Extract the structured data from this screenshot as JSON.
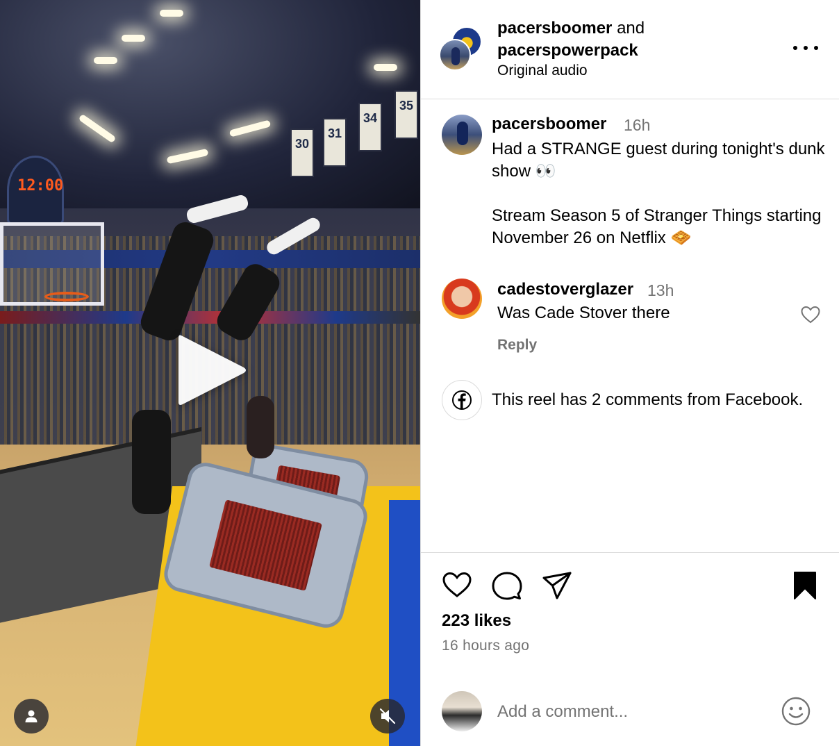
{
  "post": {
    "header": {
      "author1": "pacersboomer",
      "joiner": "and",
      "author2": "pacerspowerpack",
      "audio": "Original audio"
    },
    "caption": {
      "username": "pacersboomer",
      "time": "16h",
      "text": "Had a STRANGE guest during tonight's dunk show 👀\n\nStream Season 5 of Stranger Things starting November 26 on Netflix 🧇"
    },
    "comments": [
      {
        "username": "cadestoverglazer",
        "time": "13h",
        "text": "Was Cade Stover there",
        "reply_label": "Reply"
      }
    ],
    "facebook_note": "This reel has 2 comments from Facebook.",
    "likes": "223 likes",
    "posted_ago": "16 hours ago",
    "add_comment": {
      "placeholder": "Add a comment..."
    }
  },
  "video": {
    "scoreboard": "12:00",
    "banners": [
      "30",
      "31",
      "34",
      "35"
    ]
  },
  "icons": {
    "play": "play-icon",
    "profile": "user-icon",
    "mute": "muted-speaker-icon",
    "more": "more-options-icon",
    "like": "heart-icon",
    "comment": "comment-bubble-icon",
    "share": "paper-plane-icon",
    "save": "bookmark-icon",
    "facebook": "facebook-icon",
    "emoji": "emoji-icon"
  }
}
